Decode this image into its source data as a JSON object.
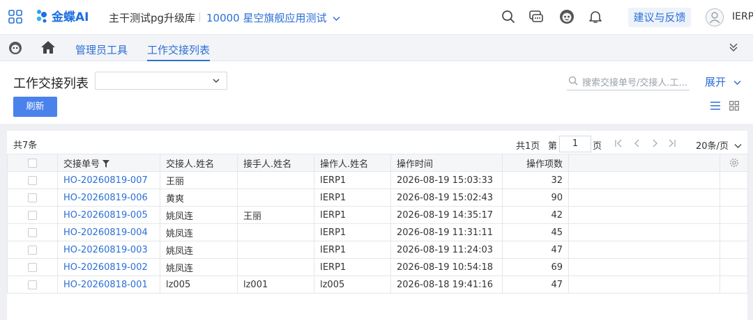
{
  "header": {
    "logo_text": "金蝶AI",
    "org_name": "主干测试pg升级库",
    "db_name": "10000 星空旗舰应用测试",
    "feedback_label": "建议与反馈",
    "user_name": "IERP"
  },
  "nav": {
    "tabs": [
      {
        "label": "管理员工具"
      },
      {
        "label": "工作交接列表"
      }
    ]
  },
  "toolbar": {
    "page_title": "工作交接列表",
    "select_value": "",
    "search_placeholder": "搜索交接单号/交接人.工...",
    "expand_label": "展开",
    "refresh_label": "刷新"
  },
  "table_panel": {
    "count_label": "共7条",
    "pager": {
      "total_pages_label": "共1页",
      "page_prefix": "第",
      "current_page": "1",
      "page_suffix": "页",
      "page_size_label": "20条/页"
    },
    "columns": [
      "交接单号",
      "交接人.姓名",
      "接手人.姓名",
      "操作人.姓名",
      "操作时间",
      "操作项数"
    ],
    "rows": [
      {
        "no": "HO-20260819-007",
        "from": "王丽",
        "to": "",
        "op": "IERP1",
        "time": "2026-08-19 15:03:33",
        "count": "32"
      },
      {
        "no": "HO-20260819-006",
        "from": "黄爽",
        "to": "",
        "op": "IERP1",
        "time": "2026-08-19 15:02:43",
        "count": "90"
      },
      {
        "no": "HO-20260819-005",
        "from": "姚凤连",
        "to": "王丽",
        "op": "IERP1",
        "time": "2026-08-19 14:35:17",
        "count": "42"
      },
      {
        "no": "HO-20260819-004",
        "from": "姚凤连",
        "to": "",
        "op": "IERP1",
        "time": "2026-08-19 11:31:11",
        "count": "45"
      },
      {
        "no": "HO-20260819-003",
        "from": "姚凤连",
        "to": "",
        "op": "IERP1",
        "time": "2026-08-19 11:24:03",
        "count": "47"
      },
      {
        "no": "HO-20260819-002",
        "from": "姚凤连",
        "to": "",
        "op": "IERP1",
        "time": "2026-08-19 10:54:18",
        "count": "69"
      },
      {
        "no": "HO-20260818-001",
        "from": "lz005",
        "to": "lz001",
        "op": "lz005",
        "time": "2026-08-18 19:41:16",
        "count": "47"
      }
    ]
  },
  "colors": {
    "accent": "#2a6fd6",
    "button": "#4a82ec"
  }
}
